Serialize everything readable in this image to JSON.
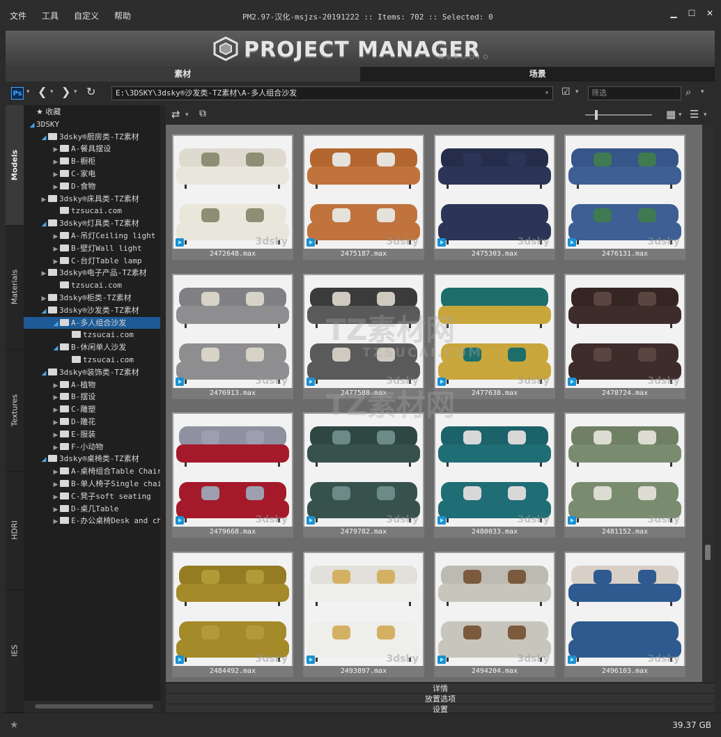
{
  "menu": [
    "文件",
    "工具",
    "自定义",
    "帮助"
  ],
  "window_title": "PM2.97-汉化-msjzs-20191222  :: Items: 702  :: Selected: 0",
  "banner": {
    "logo": "PROJECT MANAGER",
    "sub": "KSTUDIO"
  },
  "tabs": {
    "models": "素材",
    "scenes": "场景"
  },
  "toolbar": {
    "path": "E:\\3DSKY\\3dsky®沙发类-TZ素材\\A-多人组合沙发",
    "filter_placeholder": "筛选"
  },
  "side_tabs": [
    "Models",
    "Materials",
    "Textures",
    "HDRI",
    "IES"
  ],
  "tree": [
    {
      "label": "收藏",
      "level": 0,
      "arrow": "none",
      "icon": "star"
    },
    {
      "label": "3DSKY",
      "level": 0,
      "arrow": "open",
      "icon": "none"
    },
    {
      "label": "3dsky®厨房类-TZ素材",
      "level": 1,
      "arrow": "open"
    },
    {
      "label": "A-餐具摆设",
      "level": 2,
      "arrow": "closed"
    },
    {
      "label": "B-橱柜",
      "level": 2,
      "arrow": "closed"
    },
    {
      "label": "C-家电",
      "level": 2,
      "arrow": "closed"
    },
    {
      "label": "D-食物",
      "level": 2,
      "arrow": "closed"
    },
    {
      "label": "3dsky®床具类-TZ素材",
      "level": 1,
      "arrow": "closed"
    },
    {
      "label": "tzsucai.com",
      "level": 2,
      "arrow": "none"
    },
    {
      "label": "3dsky®灯具类-TZ素材",
      "level": 1,
      "arrow": "open"
    },
    {
      "label": "A-吊灯Ceiling light",
      "level": 2,
      "arrow": "closed"
    },
    {
      "label": "B-壁灯Wall light",
      "level": 2,
      "arrow": "closed"
    },
    {
      "label": "C-台灯Table lamp",
      "level": 2,
      "arrow": "closed"
    },
    {
      "label": "3dsky®电子产品-TZ素材",
      "level": 1,
      "arrow": "closed"
    },
    {
      "label": "tzsucai.com",
      "level": 2,
      "arrow": "none"
    },
    {
      "label": "3dsky®柜类-TZ素材",
      "level": 1,
      "arrow": "closed"
    },
    {
      "label": "3dsky®沙发类-TZ素材",
      "level": 1,
      "arrow": "open"
    },
    {
      "label": "A-多人组合沙发",
      "level": 2,
      "arrow": "open",
      "selected": true
    },
    {
      "label": "tzsucai.com",
      "level": 3,
      "arrow": "none"
    },
    {
      "label": "B-休闲单人沙发",
      "level": 2,
      "arrow": "open"
    },
    {
      "label": "tzsucai.com",
      "level": 3,
      "arrow": "none"
    },
    {
      "label": "3dsky®装饰类-TZ素材",
      "level": 1,
      "arrow": "open"
    },
    {
      "label": "A-植物",
      "level": 2,
      "arrow": "closed"
    },
    {
      "label": "B-摆设",
      "level": 2,
      "arrow": "closed"
    },
    {
      "label": "C-雕塑",
      "level": 2,
      "arrow": "closed"
    },
    {
      "label": "D-雕花",
      "level": 2,
      "arrow": "closed"
    },
    {
      "label": "E-服装",
      "level": 2,
      "arrow": "closed"
    },
    {
      "label": "F-小动物",
      "level": 2,
      "arrow": "closed"
    },
    {
      "label": "3dsky®桌椅类-TZ素材",
      "level": 1,
      "arrow": "open"
    },
    {
      "label": "A-桌椅组合Table Chair",
      "level": 2,
      "arrow": "closed"
    },
    {
      "label": "B-单人椅子Single chair",
      "level": 2,
      "arrow": "closed"
    },
    {
      "label": "C-凳子soft seating",
      "level": 2,
      "arrow": "closed"
    },
    {
      "label": "D-桌几Table",
      "level": 2,
      "arrow": "closed"
    },
    {
      "label": "E-办公桌椅Desk and chair",
      "level": 2,
      "arrow": "closed"
    }
  ],
  "items": [
    {
      "name": "2472648.max",
      "seat": "#e9e6dc",
      "back": "#dedad0",
      "pillow": "#8c8f74"
    },
    {
      "name": "2475187.max",
      "seat": "#c0733d",
      "back": "#b4662f",
      "pillow": "#e5e2db"
    },
    {
      "name": "2475303.max",
      "seat": "#2c3557",
      "back": "#252d4b",
      "pillow": "#2c3557"
    },
    {
      "name": "2476131.max",
      "seat": "#3e5f93",
      "back": "#365588",
      "pillow": "#3f7a52"
    },
    {
      "name": "2476913.max",
      "seat": "#8e8e90",
      "back": "#808084",
      "pillow": "#d7d3c7"
    },
    {
      "name": "2477588.max",
      "seat": "#5a5a5a",
      "back": "#3b3b3b",
      "pillow": "#cfcac0"
    },
    {
      "name": "2477638.max",
      "seat": "#c9a63c",
      "back": "#1d6e6b",
      "pillow": "#1d6e6b"
    },
    {
      "name": "2478724.max",
      "seat": "#3e2c2a",
      "back": "#352523",
      "pillow": "#5a4540"
    },
    {
      "name": "2479668.max",
      "seat": "#a41a2a",
      "back": "#8f90a0",
      "pillow": "#9d9fae"
    },
    {
      "name": "2479782.max",
      "seat": "#37524c",
      "back": "#2f4742",
      "pillow": "#6c8a86"
    },
    {
      "name": "2480033.max",
      "seat": "#1f6d75",
      "back": "#1c626a",
      "pillow": "#d8d8d8"
    },
    {
      "name": "2481152.max",
      "seat": "#7a8c6f",
      "back": "#6f8064",
      "pillow": "#dcdcd2"
    },
    {
      "name": "2484492.max",
      "seat": "#a48a29",
      "back": "#957c22",
      "pillow": "#b39a38"
    },
    {
      "name": "2493897.max",
      "seat": "#eeeeea",
      "back": "#e2e0da",
      "pillow": "#d4b063"
    },
    {
      "name": "2494204.max",
      "seat": "#c8c5bd",
      "back": "#bdbab1",
      "pillow": "#7c5a3d"
    },
    {
      "name": "2496103.max",
      "seat": "#2e5a8f",
      "back": "#d8cfc6",
      "pillow": "#2e5a8f"
    }
  ],
  "panels": [
    "详情",
    "放置选项",
    "设置"
  ],
  "status": {
    "disk_free": "39.37 GB"
  },
  "watermark": {
    "brand": "TZ素材网",
    "url": "TZSUCAI.COM",
    "site": "3dsky"
  }
}
